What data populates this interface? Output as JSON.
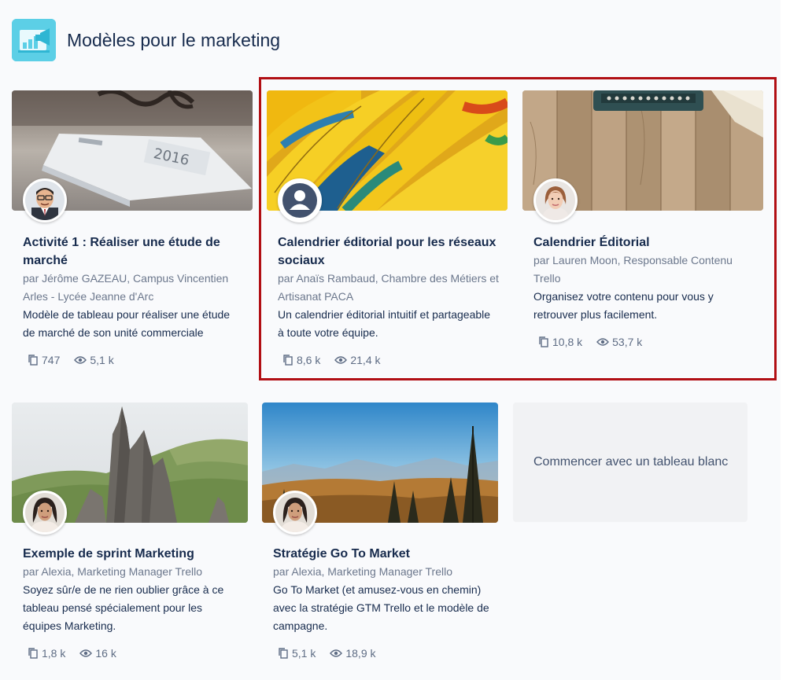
{
  "section": {
    "title": "Modèles pour le marketing",
    "icon": "marketing-megaphone-icon"
  },
  "templates": [
    {
      "title_line1": "Activité 1 : Réaliser une étude de",
      "title_line2": "marché",
      "author_line1": "par Jérôme GAZEAU, Campus Vincentien",
      "author_line2": "Arles - Lycée Jeanne d'Arc",
      "desc_line1": "Modèle de tableau pour réaliser une étude",
      "desc_line2": "de marché de son unité commerciale",
      "copies": "747",
      "views": "5,1 k"
    },
    {
      "title_line1": "Calendrier éditorial pour les réseaux",
      "title_line2": "sociaux",
      "author_line1": "par Anaïs Rambaud, Chambre des Métiers et",
      "author_line2": "Artisanat PACA",
      "desc_line1": "Un calendrier éditorial intuitif et partageable",
      "desc_line2": "à toute votre équipe.",
      "copies": "8,6 k",
      "views": "21,4 k"
    },
    {
      "title_line1": "Calendrier Éditorial",
      "author_line1": "par Lauren Moon, Responsable Contenu",
      "author_line2": "Trello",
      "desc_line1": "Organisez votre contenu pour vous y",
      "desc_line2": "retrouver plus facilement.",
      "copies": "10,8 k",
      "views": "53,7 k"
    },
    {
      "title_line1": "Exemple de sprint Marketing",
      "author_line1": "par Alexia, Marketing Manager Trello",
      "desc_line1": "Soyez sûr/e de ne rien oublier grâce à ce",
      "desc_line2": "tableau pensé spécialement pour les",
      "desc_line3": "équipes Marketing.",
      "copies": "1,8 k",
      "views": "16 k"
    },
    {
      "title_line1": "Stratégie Go To Market",
      "author_line1": "par Alexia, Marketing Manager Trello",
      "desc_line1": "Go To Market (et amusez-vous en chemin)",
      "desc_line2": "avec la stratégie GTM Trello et le modèle de",
      "desc_line3": "campagne.",
      "copies": "5,1 k",
      "views": "18,9 k"
    }
  ],
  "blank_board": {
    "label": "Commencer avec un tableau blanc"
  },
  "icons": {
    "copy": "copy-icon",
    "views": "eye-icon"
  },
  "colors": {
    "highlight": "#b10f14",
    "title": "#172b4d",
    "muted": "#6b778c",
    "header_icon_bg": "#5ccfe6"
  }
}
